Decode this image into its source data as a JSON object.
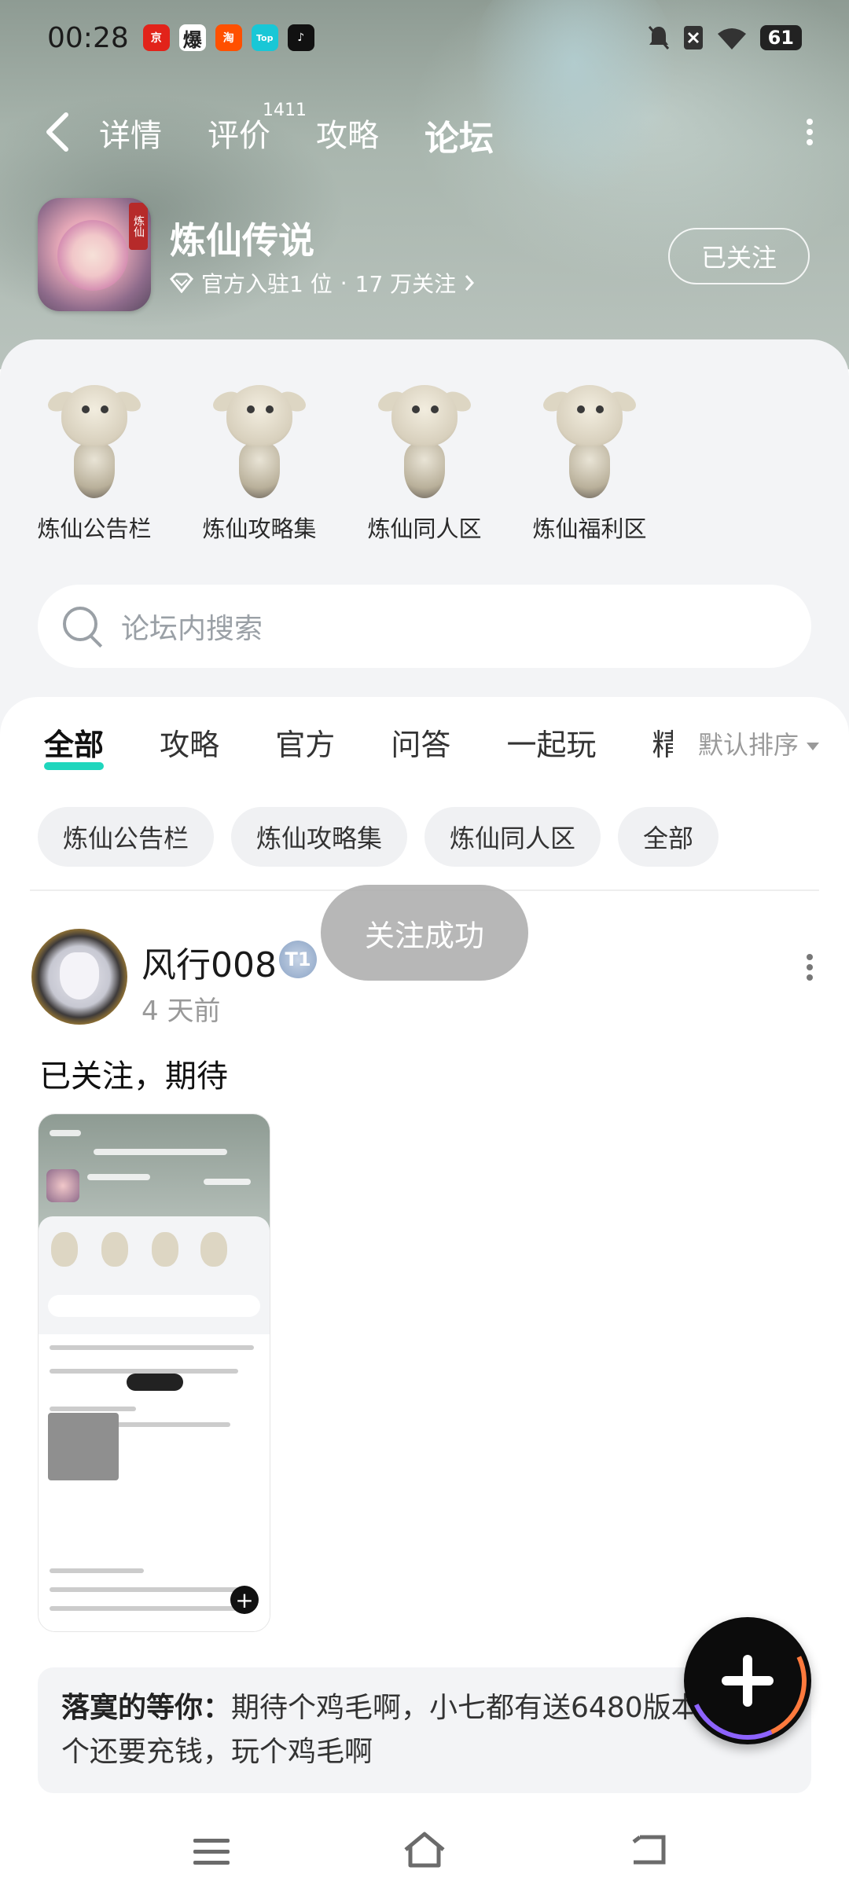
{
  "status_bar": {
    "time": "00:28",
    "battery": "61",
    "icons": [
      "jd-icon",
      "fire-icon",
      "taobao-icon",
      "top-icon",
      "tiktok-icon",
      "mute-icon",
      "wifi-icon"
    ]
  },
  "nav": {
    "tabs": [
      {
        "label": "详情"
      },
      {
        "label": "评价",
        "count": "1411"
      },
      {
        "label": "攻略"
      },
      {
        "label": "论坛",
        "active": true
      }
    ]
  },
  "game": {
    "title": "炼仙传说",
    "meta_official": "官方入驻1 位",
    "meta_sep": "·",
    "meta_followers": "17 万关注",
    "follow_button": "已关注",
    "icon_badge": "炼仙"
  },
  "channels": [
    {
      "label": "炼仙公告栏"
    },
    {
      "label": "炼仙攻略集"
    },
    {
      "label": "炼仙同人区"
    },
    {
      "label": "炼仙福利区"
    }
  ],
  "search": {
    "placeholder": "论坛内搜索"
  },
  "categories": [
    "全部",
    "攻略",
    "官方",
    "问答",
    "一起玩",
    "精"
  ],
  "sort": {
    "label": "默认排序"
  },
  "chips": [
    "炼仙公告栏",
    "炼仙攻略集",
    "炼仙同人区",
    "全部"
  ],
  "post": {
    "username": "风行008",
    "level_badge": "T1",
    "time": "4 天前",
    "text": "已关注，期待"
  },
  "comment": {
    "author": "落寞的等你：",
    "text": "期待个鸡毛啊，小七都有送6480版本，玩这个还要充钱，玩个鸡毛啊"
  },
  "toast": {
    "text": "关注成功"
  },
  "colors": {
    "accent": "#1fd6bd",
    "hero": "#a9b6ae",
    "panel": "#f3f4f6"
  }
}
